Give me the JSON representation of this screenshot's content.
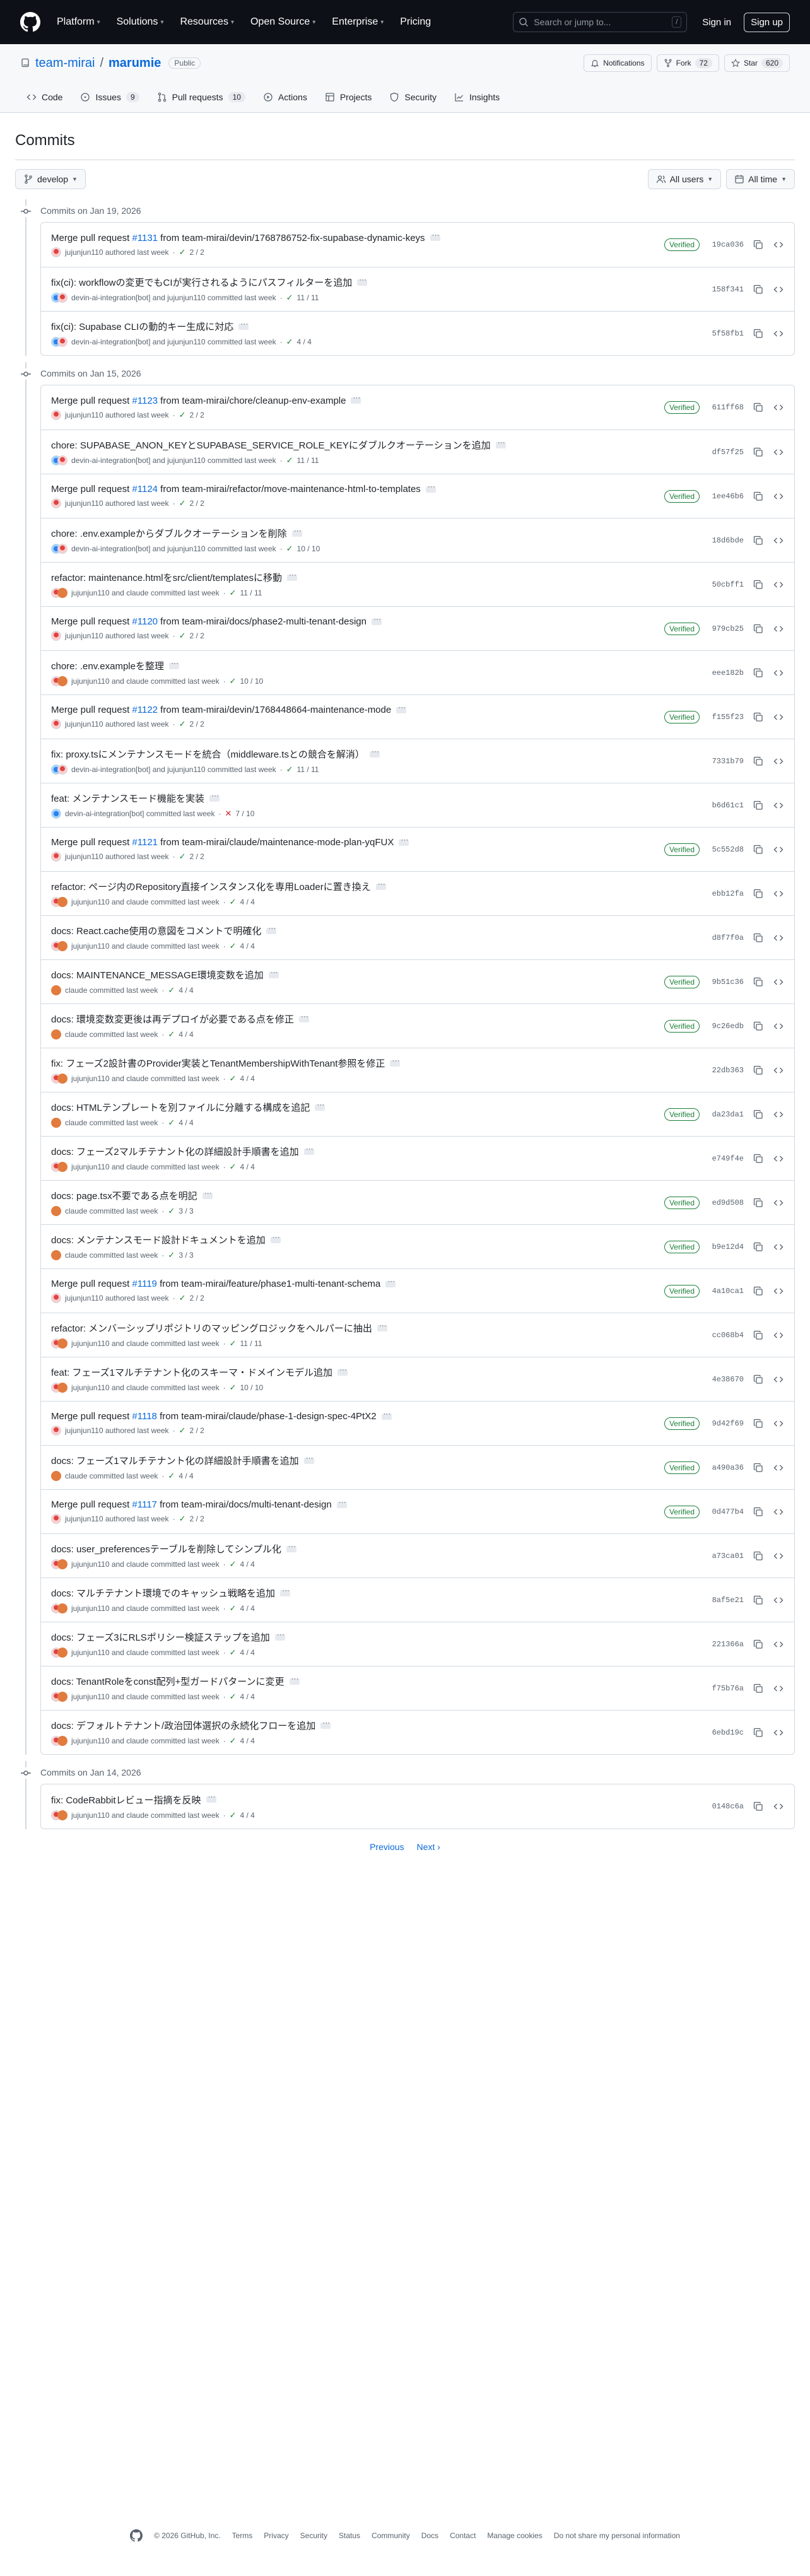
{
  "header": {
    "nav": [
      "Platform",
      "Solutions",
      "Resources",
      "Open Source",
      "Enterprise",
      "Pricing"
    ],
    "search_placeholder": "Search or jump to...",
    "search_key": "/",
    "signin": "Sign in",
    "signup": "Sign up"
  },
  "repo": {
    "owner": "team-mirai",
    "separator": "/",
    "name": "marumie",
    "visibility": "Public",
    "notifications": "Notifications",
    "fork": "Fork",
    "fork_count": "72",
    "star": "Star",
    "star_count": "620"
  },
  "tabs": [
    {
      "label": "Code"
    },
    {
      "label": "Issues",
      "count": "9"
    },
    {
      "label": "Pull requests",
      "count": "10"
    },
    {
      "label": "Actions"
    },
    {
      "label": "Projects"
    },
    {
      "label": "Security"
    },
    {
      "label": "Insights"
    }
  ],
  "page": {
    "title": "Commits",
    "branch": "develop",
    "users": "All users",
    "time": "All time"
  },
  "groups": [
    {
      "date": "Commits on Jan 19, 2026",
      "commits": [
        {
          "pre": "Merge pull request ",
          "pr": "#1131",
          "post": " from team-mirai/devin/1768786752-fix-supabase-dynamic-keys",
          "av": "j",
          "authors": "jujunjun110 authored last week",
          "ok": "2 / 2",
          "verified": true,
          "sha": "19ca036"
        },
        {
          "pre": "fix(ci): workflowの変更でもCIが実行されるようにパスフィルターを追加",
          "av": "dj",
          "authors": "devin-ai-integration[bot] and jujunjun110 committed last week",
          "ok": "11 / 11",
          "sha": "158f341"
        },
        {
          "pre": "fix(ci): Supabase CLIの動的キー生成に対応",
          "av": "dj",
          "authors": "devin-ai-integration[bot] and jujunjun110 committed last week",
          "ok": "4 / 4",
          "sha": "5f58fb1"
        }
      ]
    },
    {
      "date": "Commits on Jan 15, 2026",
      "commits": [
        {
          "pre": "Merge pull request ",
          "pr": "#1123",
          "post": " from team-mirai/chore/cleanup-env-example",
          "av": "j",
          "authors": "jujunjun110 authored last week",
          "ok": "2 / 2",
          "verified": true,
          "sha": "611ff68"
        },
        {
          "pre": "chore: SUPABASE_ANON_KEYとSUPABASE_SERVICE_ROLE_KEYにダブルクオーテーションを追加",
          "av": "dj",
          "authors": "devin-ai-integration[bot] and jujunjun110 committed last week",
          "ok": "11 / 11",
          "sha": "df57f25"
        },
        {
          "pre": "Merge pull request ",
          "pr": "#1124",
          "post": " from team-mirai/refactor/move-maintenance-html-to-templates",
          "av": "j",
          "authors": "jujunjun110 authored last week",
          "ok": "2 / 2",
          "verified": true,
          "sha": "1ee46b6"
        },
        {
          "pre": "chore: .env.exampleからダブルクオーテーションを削除",
          "av": "dj",
          "authors": "devin-ai-integration[bot] and jujunjun110 committed last week",
          "ok": "10 / 10",
          "sha": "18d6bde"
        },
        {
          "pre": "refactor: maintenance.htmlをsrc/client/templatesに移動",
          "av": "jc",
          "authors": "jujunjun110 and claude committed last week",
          "ok": "11 / 11",
          "sha": "50cbff1"
        },
        {
          "pre": "Merge pull request ",
          "pr": "#1120",
          "post": " from team-mirai/docs/phase2-multi-tenant-design",
          "av": "j",
          "authors": "jujunjun110 authored last week",
          "ok": "2 / 2",
          "verified": true,
          "sha": "979cb25"
        },
        {
          "pre": "chore: .env.exampleを整理",
          "av": "jc",
          "authors": "jujunjun110 and claude committed last week",
          "ok": "10 / 10",
          "sha": "eee182b"
        },
        {
          "pre": "Merge pull request ",
          "pr": "#1122",
          "post": " from team-mirai/devin/1768448664-maintenance-mode",
          "av": "j",
          "authors": "jujunjun110 authored last week",
          "ok": "2 / 2",
          "verified": true,
          "sha": "f155f23"
        },
        {
          "pre": "fix: proxy.tsにメンテナンスモードを統合（middleware.tsとの競合を解消）",
          "av": "dj",
          "authors": "devin-ai-integration[bot] and jujunjun110 committed last week",
          "ok": "11 / 11",
          "sha": "7331b79"
        },
        {
          "pre": "feat: メンテナンスモード機能を実装",
          "av": "d",
          "authors": "devin-ai-integration[bot] committed last week",
          "fail": "7 / 10",
          "sha": "b6d61c1"
        },
        {
          "pre": "Merge pull request ",
          "pr": "#1121",
          "post": " from team-mirai/claude/maintenance-mode-plan-yqFUX",
          "av": "j",
          "authors": "jujunjun110 authored last week",
          "ok": "2 / 2",
          "verified": true,
          "sha": "5c552d8"
        },
        {
          "pre": "refactor: ページ内のRepository直接インスタンス化を専用Loaderに置き換え",
          "av": "jc",
          "authors": "jujunjun110 and claude committed last week",
          "ok": "4 / 4",
          "sha": "ebb12fa"
        },
        {
          "pre": "docs: React.cache使用の意図をコメントで明確化",
          "av": "jc",
          "authors": "jujunjun110 and claude committed last week",
          "ok": "4 / 4",
          "sha": "d8f7f0a"
        },
        {
          "pre": "docs: MAINTENANCE_MESSAGE環境変数を追加",
          "av": "c",
          "authors": "claude committed last week",
          "ok": "4 / 4",
          "verified": true,
          "sha": "9b51c36"
        },
        {
          "pre": "docs: 環境変数変更後は再デプロイが必要である点を修正",
          "av": "c",
          "authors": "claude committed last week",
          "ok": "4 / 4",
          "verified": true,
          "sha": "9c26edb"
        },
        {
          "pre": "fix: フェーズ2設計書のProvider実装とTenantMembershipWithTenant参照を修正",
          "av": "jc",
          "authors": "jujunjun110 and claude committed last week",
          "ok": "4 / 4",
          "sha": "22db363"
        },
        {
          "pre": "docs: HTMLテンプレートを別ファイルに分離する構成を追記",
          "av": "c",
          "authors": "claude committed last week",
          "ok": "4 / 4",
          "verified": true,
          "sha": "da23da1"
        },
        {
          "pre": "docs: フェーズ2マルチテナント化の詳細設計手順書を追加",
          "av": "jc",
          "authors": "jujunjun110 and claude committed last week",
          "ok": "4 / 4",
          "sha": "e749f4e"
        },
        {
          "pre": "docs: page.tsx不要である点を明記",
          "av": "c",
          "authors": "claude committed last week",
          "ok": "3 / 3",
          "verified": true,
          "sha": "ed9d508"
        },
        {
          "pre": "docs: メンテナンスモード設計ドキュメントを追加",
          "av": "c",
          "authors": "claude committed last week",
          "ok": "3 / 3",
          "verified": true,
          "sha": "b9e12d4"
        },
        {
          "pre": "Merge pull request ",
          "pr": "#1119",
          "post": " from team-mirai/feature/phase1-multi-tenant-schema",
          "av": "j",
          "authors": "jujunjun110 authored last week",
          "ok": "2 / 2",
          "verified": true,
          "sha": "4a10ca1"
        },
        {
          "pre": "refactor: メンバーシップリポジトリのマッピングロジックをヘルパーに抽出",
          "av": "jc",
          "authors": "jujunjun110 and claude committed last week",
          "ok": "11 / 11",
          "sha": "cc068b4"
        },
        {
          "pre": "feat: フェーズ1マルチテナント化のスキーマ・ドメインモデル追加",
          "av": "jc",
          "authors": "jujunjun110 and claude committed last week",
          "ok": "10 / 10",
          "sha": "4e38670"
        },
        {
          "pre": "Merge pull request ",
          "pr": "#1118",
          "post": " from team-mirai/claude/phase-1-design-spec-4PtX2",
          "av": "j",
          "authors": "jujunjun110 authored last week",
          "ok": "2 / 2",
          "verified": true,
          "sha": "9d42f69"
        },
        {
          "pre": "docs: フェーズ1マルチテナント化の詳細設計手順書を追加",
          "av": "c",
          "authors": "claude committed last week",
          "ok": "4 / 4",
          "verified": true,
          "sha": "a490a36"
        },
        {
          "pre": "Merge pull request ",
          "pr": "#1117",
          "post": " from team-mirai/docs/multi-tenant-design",
          "av": "j",
          "authors": "jujunjun110 authored last week",
          "ok": "2 / 2",
          "verified": true,
          "sha": "0d477b4"
        },
        {
          "pre": "docs: user_preferencesテーブルを削除してシンプル化",
          "av": "jc",
          "authors": "jujunjun110 and claude committed last week",
          "ok": "4 / 4",
          "sha": "a73ca01"
        },
        {
          "pre": "docs: マルチテナント環境でのキャッシュ戦略を追加",
          "av": "jc",
          "authors": "jujunjun110 and claude committed last week",
          "ok": "4 / 4",
          "sha": "8af5e21"
        },
        {
          "pre": "docs: フェーズ3にRLSポリシー検証ステップを追加",
          "av": "jc",
          "authors": "jujunjun110 and claude committed last week",
          "ok": "4 / 4",
          "sha": "221366a"
        },
        {
          "pre": "docs: TenantRoleをconst配列+型ガードパターンに変更",
          "av": "jc",
          "authors": "jujunjun110 and claude committed last week",
          "ok": "4 / 4",
          "sha": "f75b76a"
        },
        {
          "pre": "docs: デフォルトテナント/政治団体選択の永続化フローを追加",
          "av": "jc",
          "authors": "jujunjun110 and claude committed last week",
          "ok": "4 / 4",
          "sha": "6ebd19c"
        }
      ]
    },
    {
      "date": "Commits on Jan 14, 2026",
      "commits": [
        {
          "pre": "fix: CodeRabbitレビュー指摘を反映",
          "av": "jc",
          "authors": "jujunjun110 and claude committed last week",
          "ok": "4 / 4",
          "sha": "0148c6a"
        }
      ]
    }
  ],
  "pagination": {
    "previous": "Previous",
    "next": "Next"
  },
  "footer": {
    "copyright": "© 2026 GitHub, Inc.",
    "links": [
      "Terms",
      "Privacy",
      "Security",
      "Status",
      "Community",
      "Docs",
      "Contact",
      "Manage cookies",
      "Do not share my personal information"
    ]
  },
  "verified_label": "Verified",
  "colors": {
    "header_bg": "#0d1117",
    "link": "#0969da",
    "success": "#1a7f37",
    "danger": "#d1242f"
  }
}
